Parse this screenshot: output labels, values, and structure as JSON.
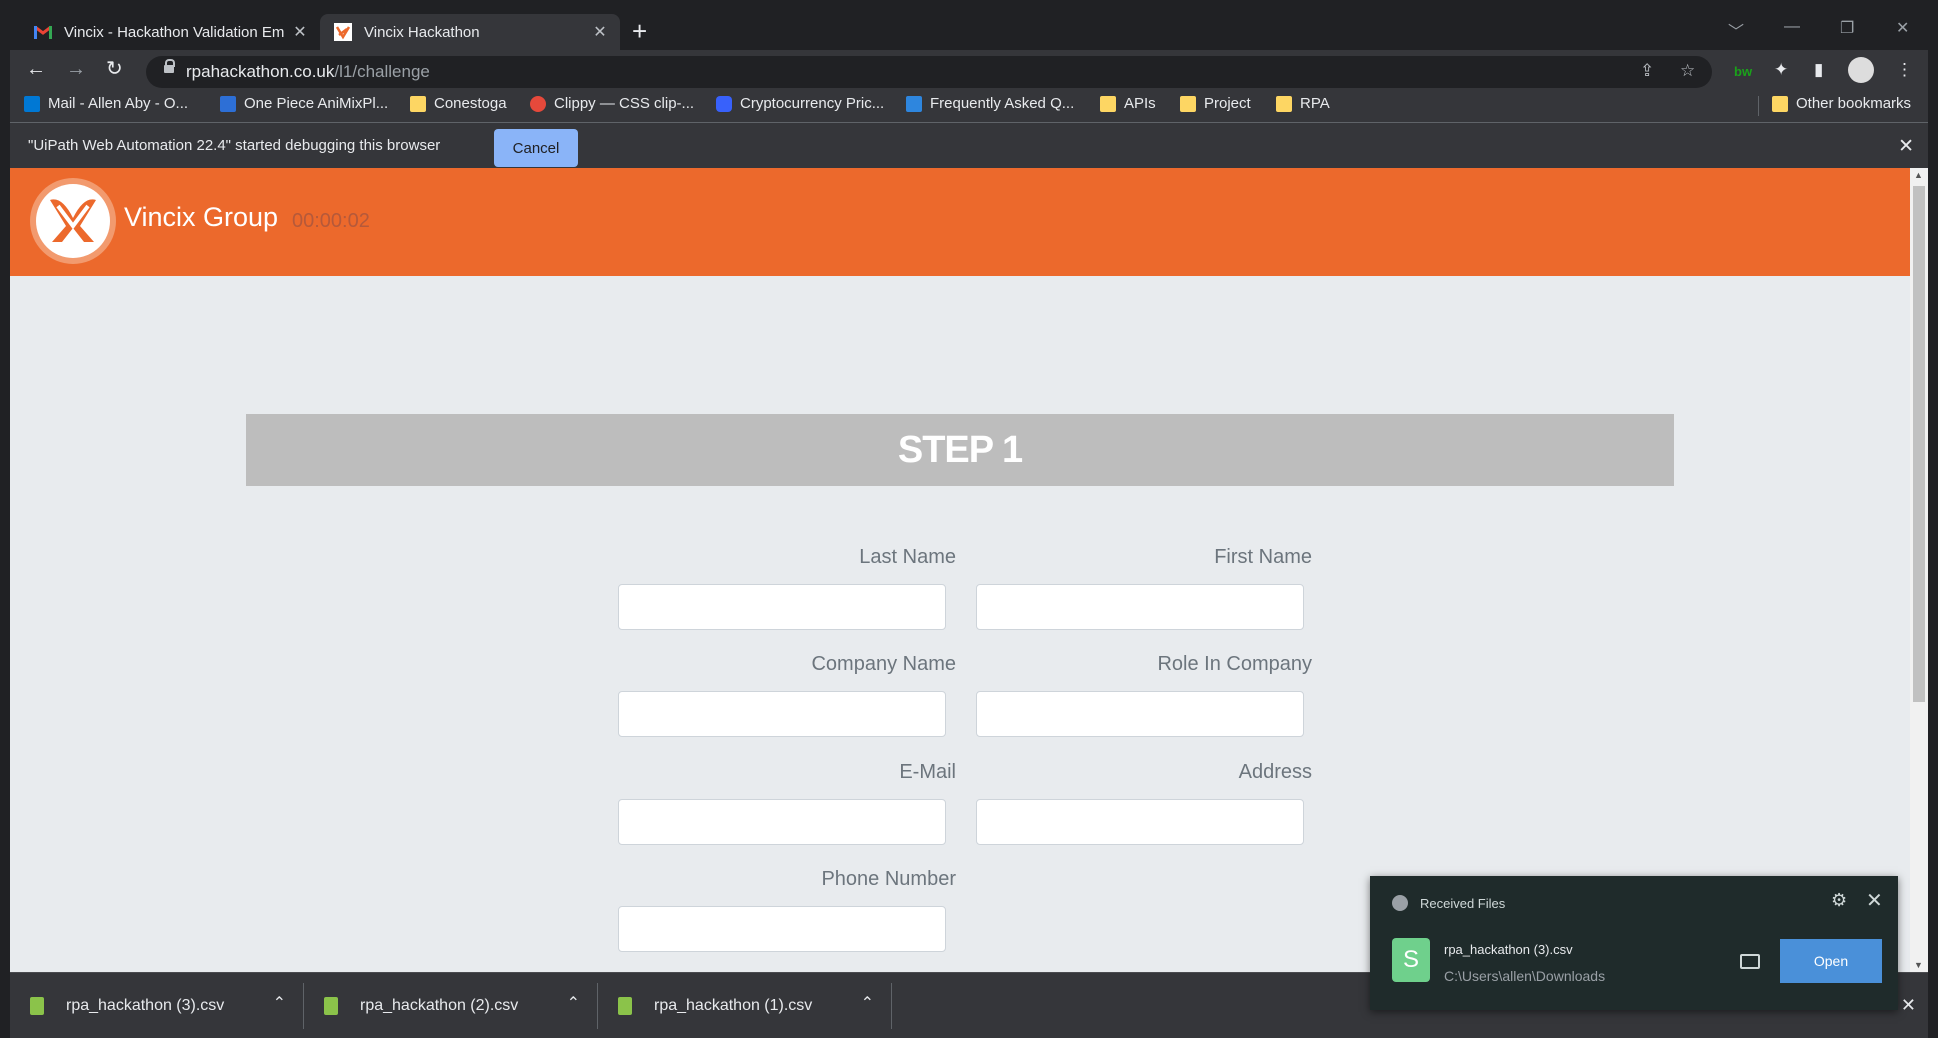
{
  "tabs": [
    {
      "title": "Vincix - Hackathon Validation Em",
      "close": "✕"
    },
    {
      "title": "Vincix Hackathon",
      "close": "✕"
    }
  ],
  "new_tab": "+",
  "window_controls": {
    "dropdown": "﹀",
    "minimize": "—",
    "maximize": "❐",
    "close": "✕"
  },
  "nav": {
    "back": "←",
    "forward": "→",
    "reload": "↻"
  },
  "address": {
    "host": "rpahackathon.co.uk",
    "path": "/l1/challenge"
  },
  "toolbar_icons": {
    "share": "⇪",
    "star": "☆",
    "extension_label": "bw",
    "puzzle": "✦",
    "sidepanel": "▮",
    "menu": "⋮"
  },
  "bookmarks": [
    {
      "label": "Mail - Allen Aby - O..."
    },
    {
      "label": "One Piece AniMixPl..."
    },
    {
      "label": "Conestoga"
    },
    {
      "label": "Clippy — CSS clip-..."
    },
    {
      "label": "Cryptocurrency Pric..."
    },
    {
      "label": "Frequently Asked Q..."
    },
    {
      "label": "APIs"
    },
    {
      "label": "Project"
    },
    {
      "label": "RPA"
    }
  ],
  "other_bookmarks": "Other bookmarks",
  "infobar": {
    "message": "\"UiPath Web Automation 22.4\" started debugging this browser",
    "cancel": "Cancel",
    "close": "✕"
  },
  "site": {
    "brand": "Vincix Group",
    "timer": "00:00:02",
    "step_title": "STEP 1",
    "fields": [
      {
        "label": "Last Name",
        "value": ""
      },
      {
        "label": "First Name",
        "value": ""
      },
      {
        "label": "Company Name",
        "value": ""
      },
      {
        "label": "Role In Company",
        "value": ""
      },
      {
        "label": "E-Mail",
        "value": ""
      },
      {
        "label": "Address",
        "value": ""
      },
      {
        "label": "Phone Number",
        "value": ""
      }
    ]
  },
  "downloads": [
    {
      "name": "rpa_hackathon (3).csv"
    },
    {
      "name": "rpa_hackathon (2).csv"
    },
    {
      "name": "rpa_hackathon (1).csv"
    }
  ],
  "shelf_close": "✕",
  "notification": {
    "header": "Received Files",
    "file_name": "rpa_hackathon (3).csv",
    "file_path": "C:\\Users\\allen\\Downloads",
    "open_label": "Open",
    "close": "✕",
    "gear": "⚙"
  },
  "colors": {
    "brand_orange": "#ec692c",
    "step_grey": "#bdbdbd",
    "accent_blue": "#8ab4f8"
  }
}
